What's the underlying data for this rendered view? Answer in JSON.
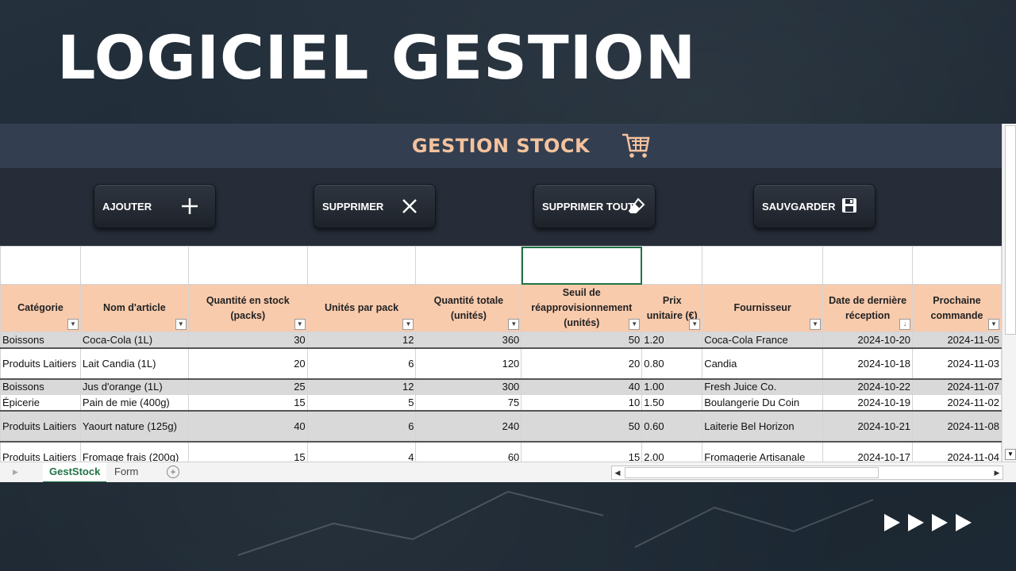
{
  "headline": "LOGICIEL GESTION",
  "banner": {
    "title": "GESTION STOCK",
    "icon": "shopping-cart-icon"
  },
  "toolbar": {
    "add_label": "AJOUTER",
    "delete_label": "SUPPRIMER",
    "delete_all_label": "SUPPRIMER TOUT",
    "save_label": "SAUVGARDER"
  },
  "table": {
    "headers": [
      "Catégorie",
      "Nom d'article",
      "Quantité en stock (packs)",
      "Unités par pack",
      "Quantité totale (unités)",
      "Seuil de réapprovisionnement (unités)",
      "Prix unitaire (€)",
      "Fournisseur",
      "Date de dernière réception",
      "Prochaine commande"
    ],
    "rows": [
      [
        "Boissons",
        "Coca-Cola (1L)",
        "30",
        "12",
        "360",
        "50",
        "1.20",
        "Coca-Cola France",
        "2024-10-20",
        "2024-11-05"
      ],
      [
        "Produits Laitiers",
        "Lait Candia (1L)",
        "20",
        "6",
        "120",
        "20",
        "0.80",
        "Candia",
        "2024-10-18",
        "2024-11-03"
      ],
      [
        "Boissons",
        "Jus d'orange (1L)",
        "25",
        "12",
        "300",
        "40",
        "1.00",
        "Fresh Juice Co.",
        "2024-10-22",
        "2024-11-07"
      ],
      [
        "Épicerie",
        "Pain de mie (400g)",
        "15",
        "5",
        "75",
        "10",
        "1.50",
        "Boulangerie Du Coin",
        "2024-10-19",
        "2024-11-02"
      ],
      [
        "Produits Laitiers",
        "Yaourt nature (125g)",
        "40",
        "6",
        "240",
        "50",
        "0.60",
        "Laiterie Bel Horizon",
        "2024-10-21",
        "2024-11-08"
      ],
      [
        "Produits Laitiers",
        "Fromage frais (200g)",
        "15",
        "4",
        "60",
        "15",
        "2.00",
        "Fromagerie Artisanale",
        "2024-10-17",
        "2024-11-04"
      ]
    ]
  },
  "sheets": {
    "active": "GestStock",
    "other": "Form"
  }
}
